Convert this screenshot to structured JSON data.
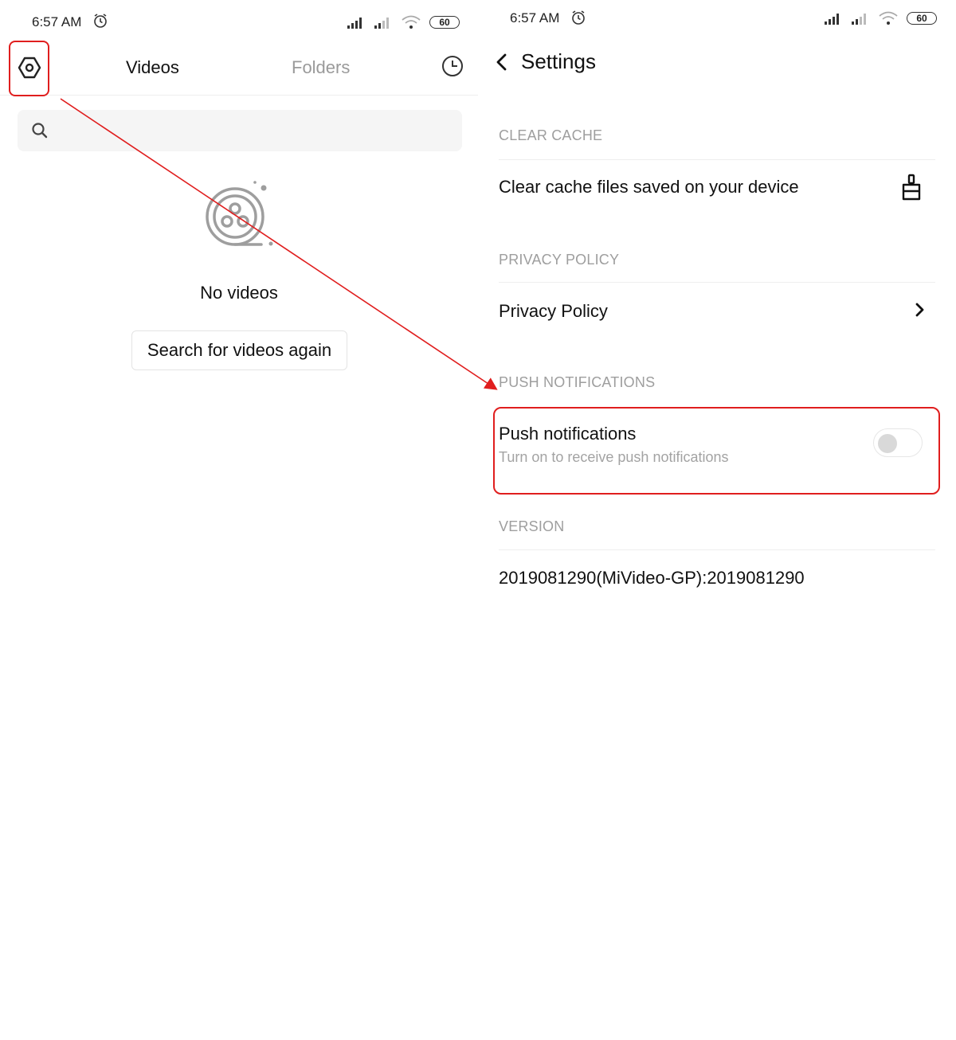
{
  "left_screen": {
    "status": {
      "time": "6:57 AM",
      "battery": "60"
    },
    "tabs": [
      {
        "label": "Videos"
      },
      {
        "label": "Folders"
      }
    ],
    "search": {
      "placeholder": ""
    },
    "empty_state": {
      "message": "No videos",
      "button_label": "Search for videos again"
    }
  },
  "right_screen": {
    "status": {
      "time": "6:57 AM",
      "battery": "60"
    },
    "header": {
      "title": "Settings"
    },
    "sections": {
      "clear_cache": {
        "label": "CLEAR CACHE",
        "row_title": "Clear cache files saved on your device"
      },
      "privacy": {
        "label": "PRIVACY POLICY",
        "row_title": "Privacy Policy"
      },
      "push": {
        "label": "PUSH NOTIFICATIONS",
        "row_title": "Push notifications",
        "row_subtitle": "Turn on to receive push notifications",
        "enabled": false
      },
      "version": {
        "label": "VERSION",
        "value": "2019081290(MiVideo-GP):2019081290"
      }
    }
  },
  "colors": {
    "annotation": "#e01e1e",
    "section_label": "#9e9e9e",
    "inactive_tab": "#9a9a9a"
  },
  "icons": [
    "gear-icon",
    "history-icon",
    "search-icon",
    "film-reel-icon",
    "back-arrow-icon",
    "broom-icon",
    "chevron-right-icon",
    "alarm-icon",
    "signal-icon",
    "wifi-icon",
    "battery-icon"
  ]
}
